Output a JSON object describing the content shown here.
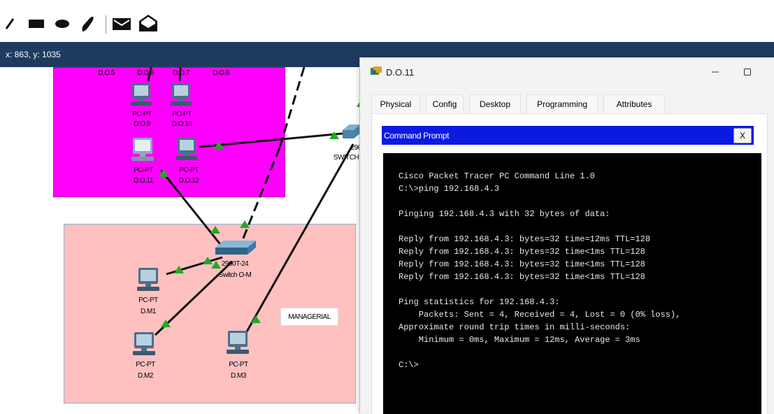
{
  "coords": {
    "label": "x: 863, y: 1035"
  },
  "canvas": {
    "zone_label": "MANAGERIAL",
    "top_labels": [
      "D.O.5",
      "D.O.6",
      "D.O.7",
      "D.O.8"
    ],
    "devices": [
      {
        "type": "PC-PT",
        "name": "D.O.9"
      },
      {
        "type": "PC-PT",
        "name": "D.O.10"
      },
      {
        "type": "PC-PT",
        "name": "D.O.11"
      },
      {
        "type": "PC-PT",
        "name": "D.O.12"
      },
      {
        "type": "PC-PT",
        "name": "D.M1"
      },
      {
        "type": "PC-PT",
        "name": "D.M2"
      },
      {
        "type": "PC-PT",
        "name": "D.M3"
      }
    ],
    "switch_main": {
      "model": "2960T-24",
      "name": "Switch O-M"
    },
    "switch_partial": {
      "model": "296",
      "name": "SWITCH"
    }
  },
  "window": {
    "title": "D.O.11",
    "tabs": [
      "Physical",
      "Config",
      "Desktop",
      "Programming",
      "Attributes"
    ],
    "active_tab": "Desktop",
    "app_title": "Command Prompt",
    "close_label": "X",
    "terminal_lines": [
      "Cisco Packet Tracer PC Command Line 1.0",
      "C:\\>ping 192.168.4.3",
      "",
      "Pinging 192.168.4.3 with 32 bytes of data:",
      "",
      "Reply from 192.168.4.3: bytes=32 time=12ms TTL=128",
      "Reply from 192.168.4.3: bytes=32 time<1ms TTL=128",
      "Reply from 192.168.4.3: bytes=32 time<1ms TTL=128",
      "Reply from 192.168.4.3: bytes=32 time<1ms TTL=128",
      "",
      "Ping statistics for 192.168.4.3:",
      "    Packets: Sent = 4, Received = 4, Lost = 0 (0% loss),",
      "Approximate round trip times in milli-seconds:",
      "    Minimum = 0ms, Maximum = 12ms, Average = 3ms",
      "",
      "C:\\>"
    ]
  },
  "colors": {
    "magenta_zone": "#ff00ff",
    "pink_zone": "#ffc0c0",
    "link_up": "#22aa22",
    "cmd_bar": "#0b1ae0",
    "coord_bar": "#1e3b5f"
  },
  "icons": {
    "toolbar": [
      "line-tool-icon",
      "rectangle-tool-icon",
      "ellipse-tool-icon",
      "freeform-tool-icon",
      "simple-pdu-icon",
      "complex-pdu-icon"
    ],
    "window": [
      "packet-tracer-app-icon",
      "minimize-icon",
      "maximize-icon"
    ]
  }
}
